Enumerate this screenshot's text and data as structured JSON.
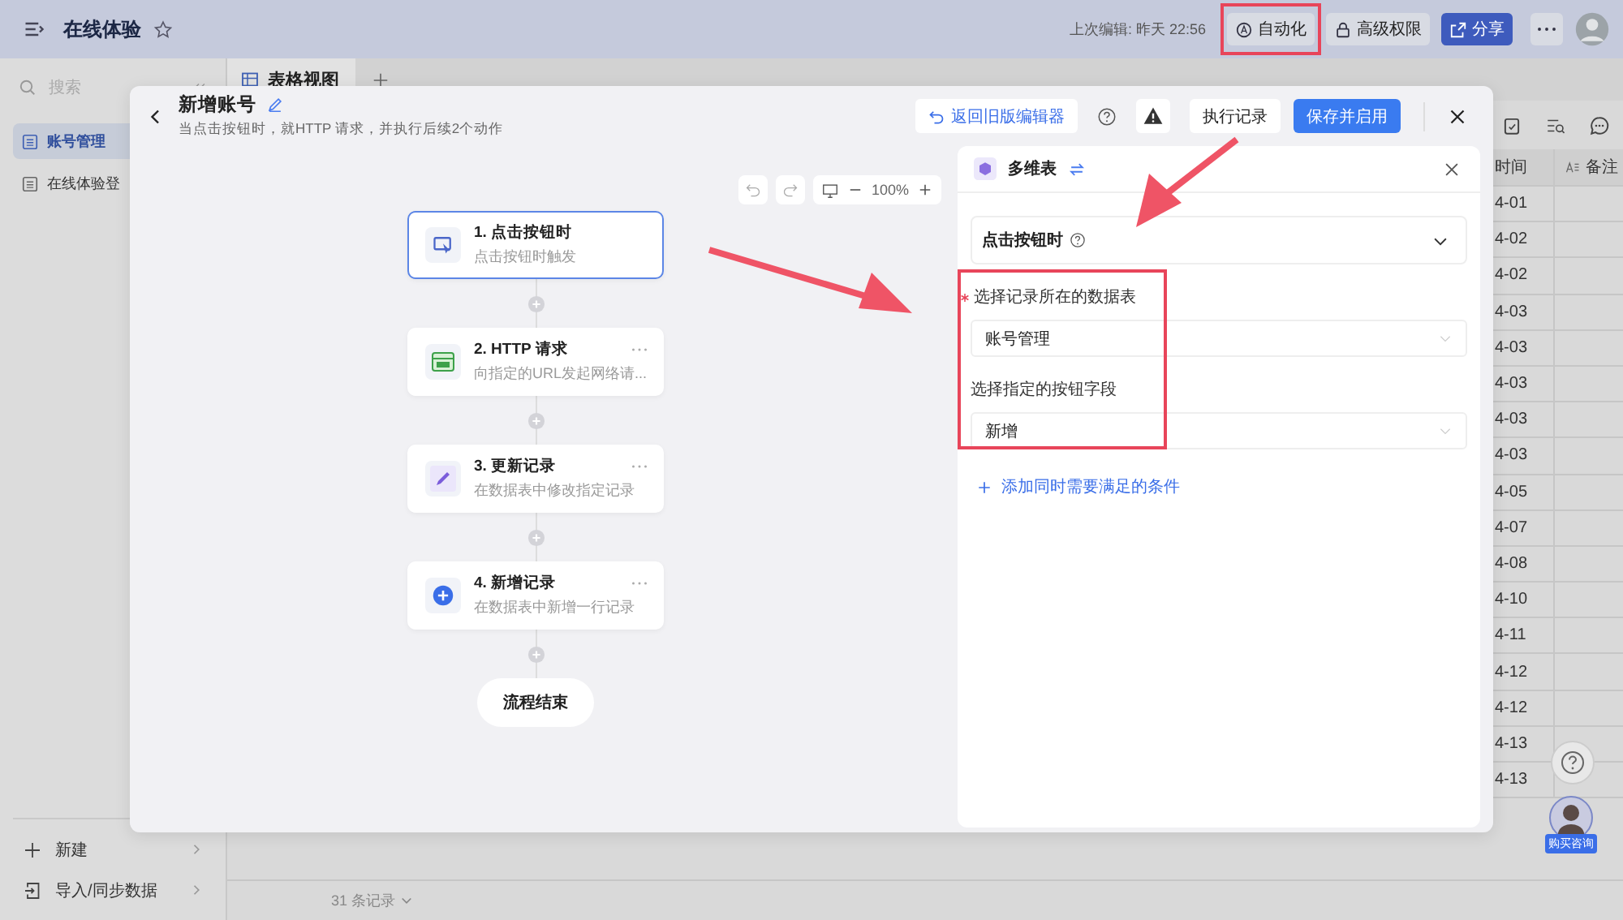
{
  "app_bar": {
    "title": "在线体验",
    "last_edited": "上次编辑: 昨天 22:56",
    "buttons": [
      {
        "label": "自动化",
        "kind": "automation"
      },
      {
        "label": "高级权限",
        "kind": "permission"
      },
      {
        "label": "分享",
        "kind": "share"
      }
    ]
  },
  "sidebar": {
    "search": {
      "placeholder": "搜索"
    },
    "items": [
      {
        "label": "账号管理",
        "selected": true
      },
      {
        "label": "在线体验登",
        "selected": false
      }
    ],
    "footer_items": [
      {
        "label": "新建",
        "kind": "new"
      },
      {
        "label": "导入/同步数据",
        "kind": "import"
      }
    ]
  },
  "view_tabs": [
    {
      "label": "表格视图",
      "selected": true
    }
  ],
  "table": {
    "columns": [
      {
        "label": "时间",
        "kind": "date"
      },
      {
        "label": "备注",
        "kind": "text"
      }
    ],
    "dates": [
      "4-01",
      "4-02",
      "4-02",
      "4-03",
      "4-03",
      "4-03",
      "4-03",
      "4-03",
      "4-05",
      "4-07",
      "4-08",
      "4-10",
      "4-11",
      "4-12",
      "4-12",
      "4-13",
      "4-13"
    ]
  },
  "record_count": "31 条记录",
  "modal": {
    "title": "新增账号",
    "subtitle": "当点击按钮时，就HTTP 请求，并执行后续2个动作",
    "buttons": [
      {
        "label": "返回旧版编辑器",
        "kind": "legacy"
      },
      {
        "label": "执行记录",
        "kind": "secondary"
      },
      {
        "label": "保存并启用",
        "kind": "primary"
      }
    ],
    "zoom": "100%",
    "nodes": [
      {
        "title": "1. 点击按钮时",
        "desc": "点击按钮时触发",
        "kind": "trigger",
        "selected": true
      },
      {
        "title": "2. HTTP 请求",
        "desc": "向指定的URL发起网络请...",
        "kind": "http",
        "selected": false
      },
      {
        "title": "3. 更新记录",
        "desc": "在数据表中修改指定记录",
        "kind": "update",
        "selected": false
      },
      {
        "title": "4. 新增记录",
        "desc": "在数据表中新增一行记录",
        "kind": "add",
        "selected": false
      }
    ],
    "end_label": "流程结束",
    "panel": {
      "title": "多维表",
      "trigger": "点击按钮时",
      "fields": [
        {
          "label": "选择记录所在的数据表",
          "required": true,
          "value": "账号管理"
        },
        {
          "label": "选择指定的按钮字段",
          "required": false,
          "value": "新增"
        }
      ],
      "add_condition": "添加同时需要满足的条件"
    }
  },
  "support_badge": "购买咨询"
}
